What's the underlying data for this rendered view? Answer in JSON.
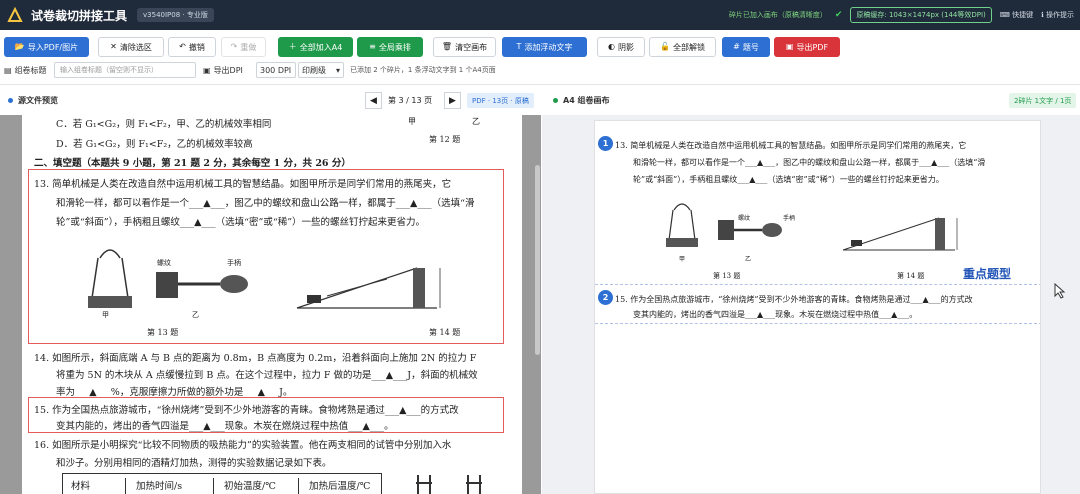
{
  "app": {
    "title": "试卷裁切拼接工具",
    "version": "v3540IP08 · 专业版"
  },
  "titlebar": {
    "status": "碎片已加入画布（原稿清晰度）",
    "cache": "原稿缓存: 1043×1474px (144等效DPI)",
    "shortcuts": "快捷键",
    "help": "操作提示"
  },
  "toolbar": {
    "import": "导入PDF/图片",
    "clear_selection": "清除选区",
    "undo": "撤销",
    "redo": "重做",
    "add_all_a4": "全部加入A4",
    "add_all_row": "全局乘排",
    "clear_canvas": "清空画布",
    "add_floating_text": "添加浮动文字",
    "shadow": "阴影",
    "unlock_all": "全部解锁",
    "numbering": "题号",
    "export_pdf": "导出PDF"
  },
  "row2": {
    "title_label": "组卷标题",
    "title_placeholder": "输入组卷标题（留空则不显示）",
    "dpi_label": "导出DPI",
    "dpi_value": "300 DPI",
    "mode_value": "印刷级",
    "status": "已添加 2 个碎片，1 条浮动文字到 1 个A4页面"
  },
  "left_panel": {
    "title": "源文件预览",
    "page_info": "第 3 / 13 页",
    "badge": "PDF · 13页 · 原稿"
  },
  "right_panel": {
    "title": "A4 组卷画布",
    "badge": "2碎片 1文字 / 1页"
  },
  "doc": {
    "l1": "C．若 G₁<G₂，则 F₁<F₂，甲、乙的机械效率相同",
    "l1b": "甲",
    "l1c": "乙",
    "l2": "D．若 G₁<G₂，则 F₁<F₂，乙的机械效率较高",
    "l2b": "第 12 题",
    "l3": "二、填空题（本题共 9 小题，第 21 题 2 分，其余每空 1 分，共 26 分）",
    "q13a": "13.  简单机械是人类在改造自然中运用机械工具的智慧结晶。如图甲所示是同学们常用的燕尾夹，它",
    "q13b": "和滑轮一样，都可以看作是一个___▲___，图乙中的螺纹和盘山公路一样，都属于___▲___（选填“滑",
    "q13c": "轮”或“斜面”），手柄粗且螺纹___▲___（选填“密”或“稀”）一些的螺丝钉拧起来更省力。",
    "cap13": "第 13 题",
    "cap14": "第 14 题",
    "fig_jia": "甲",
    "fig_yi": "乙",
    "fig_luowen": "螺纹",
    "fig_shoubing": "手柄",
    "q14a": "14.  如图所示，斜面底端 A 与 B 点的距离为 0.8m，B 点高度为 0.2m，沿着斜面向上施加 2N 的拉力 F",
    "q14b": "将重为 5N 的木块从 A 点缓慢拉到 B 点。在这个过程中，拉力 F 做的功是___▲___J，斜面的机械效",
    "q14c": "率为___▲___%，克服摩擦力所做的额外功是___▲___J。",
    "q15a": "15.  作为全国热点旅游城市，“徐州烧烤”受到不少外地游客的青睐。食物烤熟是通过___▲___的方式改",
    "q15b": "变其内能的，烤出的香气四溢是___▲___现象。木炭在燃烧过程中热值___▲___。",
    "q16a": "16.  如图所示是小明探究“比较不同物质的吸热能力”的实验装置。他在两支相同的试管中分别加入水",
    "q16b": "和沙子。分别用相同的酒精灯加热，测得的实验数据记录如下表。",
    "t_h1": "材料",
    "t_h2": "加热时间/s",
    "t_h3": "初始温度/℃",
    "t_h4": "加热后温度/℃"
  },
  "canvas": {
    "n1": "1",
    "n2": "2",
    "c13a": "13.  简单机械是人类在改造自然中运用机械工具的智慧结晶。如图甲所示是同学们常用的燕尾夹，它",
    "c13b": "和滑轮一样，都可以看作是一个___▲___，图乙中的螺纹和盘山公路一样，都属于___▲___（选填“滑",
    "c13c": "轮”或“斜面”），手柄粗且螺纹___▲___（选填“密”或“稀”）一些的螺丝钉拧起来更省力。",
    "cap13": "第 13 题",
    "cap14": "第 14 题",
    "fig_jia": "甲",
    "fig_yi": "乙",
    "fig_luowen": "螺纹",
    "fig_shoubing": "手柄",
    "c15a": "15.  作为全国热点旅游城市，“徐州烧烤”受到不少外地游客的青睐。食物烤熟是通过___▲___的方式改",
    "c15b": "变其内能的，烤出的香气四溢是___▲___现象。木炭在燃烧过程中热值___▲___。",
    "sticky": "重点题型"
  },
  "colors": {
    "titlebar": "#1f2a3a",
    "blue": "#2d6fd2",
    "green": "#1f9a4b",
    "red": "#d9343a",
    "highlight": "#e45b5b"
  }
}
